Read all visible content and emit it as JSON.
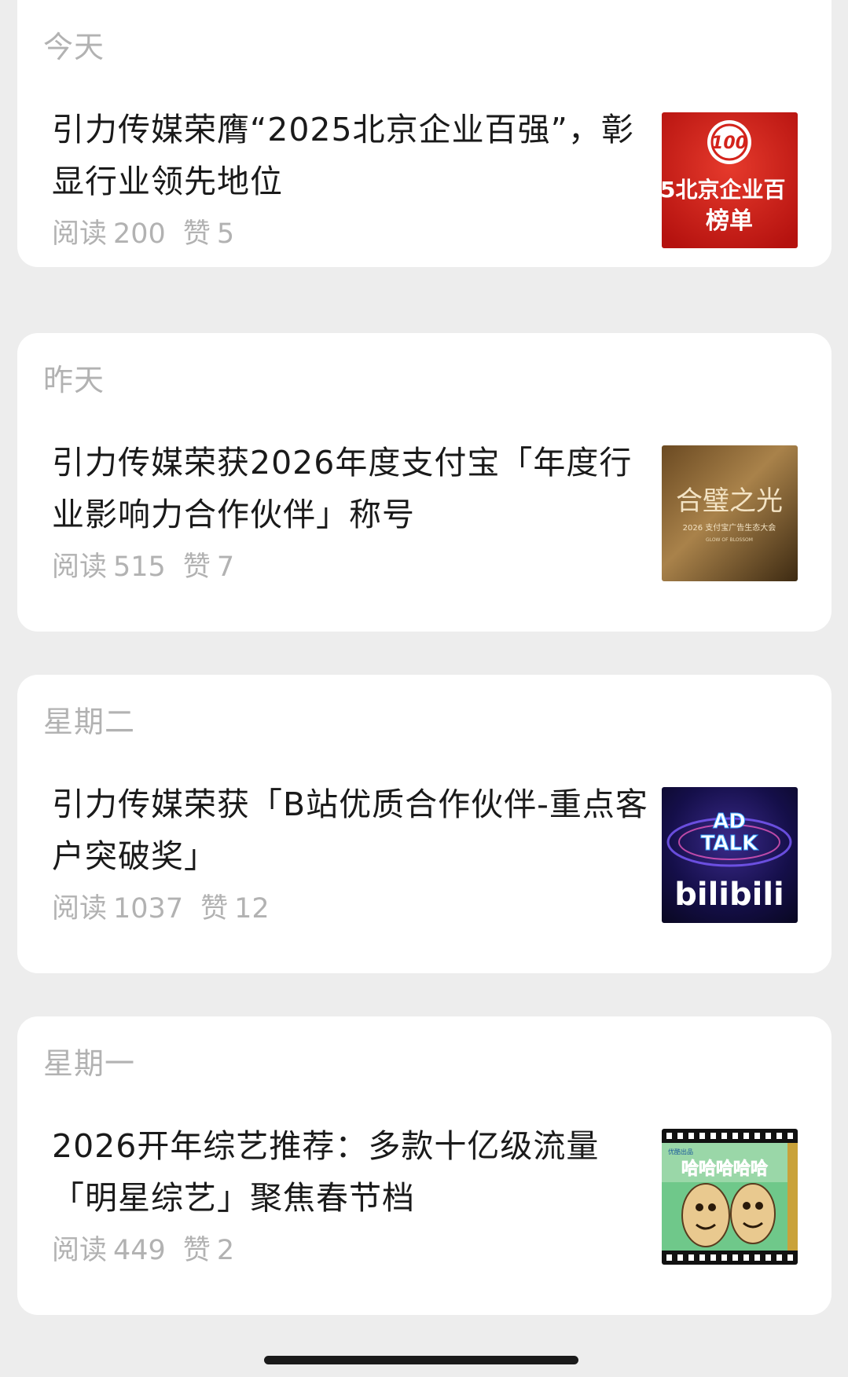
{
  "feed": [
    {
      "day": "今天",
      "title": "引力传媒荣膺“2025北京企业百强”，彰显行业领先地位",
      "read_label": "阅读",
      "reads": "200",
      "like_label": "赞",
      "likes": "5",
      "thumb": {
        "badge": "100",
        "line1": "5北京企业百",
        "line2": "榜单"
      }
    },
    {
      "day": "昨天",
      "title": "引力传媒荣获2026年度支付宝「年度行业影响力合作伙伴」称号",
      "read_label": "阅读",
      "reads": "515",
      "like_label": "赞",
      "likes": "7",
      "thumb": {
        "line1": "合璧之光",
        "line2": "2026 支付宝广告生态大会",
        "line3": "GLOW OF BLOSSOM"
      }
    },
    {
      "day": "星期二",
      "title": "引力传媒荣获「B站优质合作伙伴-重点客户突破奖」",
      "read_label": "阅读",
      "reads": "1037",
      "like_label": "赞",
      "likes": "12",
      "thumb": {
        "line1": "AD",
        "line2": "TALK",
        "line3": "bilibili"
      }
    },
    {
      "day": "星期一",
      "title": "2026开年综艺推荐：多款十亿级流量「明星综艺」聚焦春节档",
      "read_label": "阅读",
      "reads": "449",
      "like_label": "赞",
      "likes": "2",
      "thumb": {
        "line1": "哈哈哈哈哈",
        "line2": "优酷出品"
      }
    }
  ],
  "colors": {
    "background": "#ededed",
    "card": "#ffffff",
    "title_text": "#1a1a1a",
    "meta_text": "#b2b2b2"
  }
}
